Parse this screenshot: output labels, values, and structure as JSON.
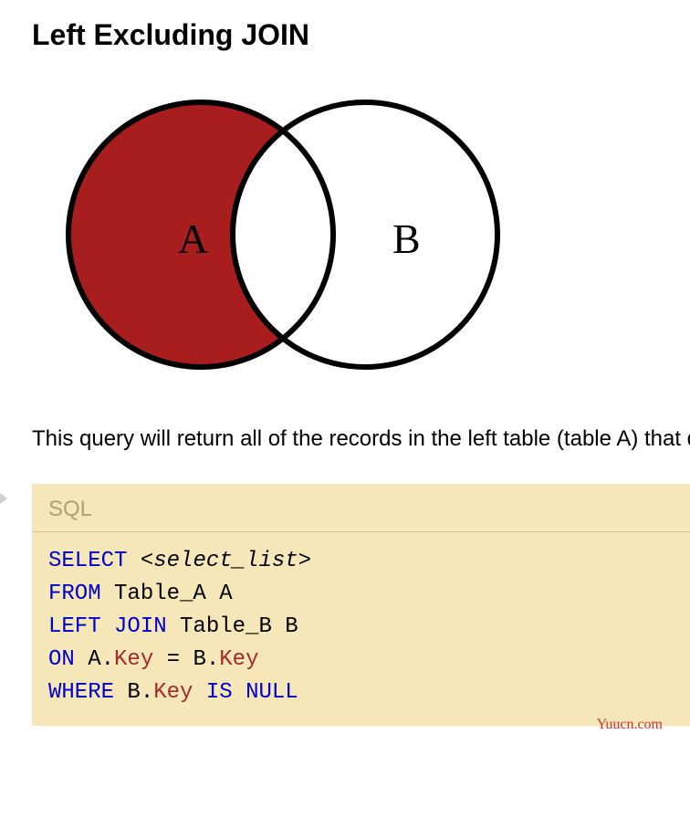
{
  "heading": "Left Excluding JOIN",
  "venn": {
    "labelA": "A",
    "labelB": "B"
  },
  "description": "This query will return all of the records in the left table (table A) that do not match any records in the right table (table B). This Join is written as follows:",
  "code": {
    "label": "SQL",
    "tokens": [
      {
        "t": "SELECT",
        "cls": "kw"
      },
      {
        "t": " ",
        "cls": "plain"
      },
      {
        "t": "<select_list>",
        "cls": "italic plain"
      },
      {
        "t": "\n",
        "cls": "plain"
      },
      {
        "t": "FROM",
        "cls": "kw"
      },
      {
        "t": " Table_A A\n",
        "cls": "plain"
      },
      {
        "t": "LEFT",
        "cls": "kw"
      },
      {
        "t": " ",
        "cls": "plain"
      },
      {
        "t": "JOIN",
        "cls": "kw"
      },
      {
        "t": " Table_B B\n",
        "cls": "plain"
      },
      {
        "t": "ON",
        "cls": "kw"
      },
      {
        "t": " A.",
        "cls": "plain"
      },
      {
        "t": "Key",
        "cls": "ident"
      },
      {
        "t": " = B.",
        "cls": "plain"
      },
      {
        "t": "Key",
        "cls": "ident"
      },
      {
        "t": "\n",
        "cls": "plain"
      },
      {
        "t": "WHERE",
        "cls": "kw"
      },
      {
        "t": " B.",
        "cls": "plain"
      },
      {
        "t": "Key",
        "cls": "ident"
      },
      {
        "t": " ",
        "cls": "plain"
      },
      {
        "t": "IS",
        "cls": "kw"
      },
      {
        "t": " ",
        "cls": "plain"
      },
      {
        "t": "NULL",
        "cls": "kw"
      }
    ]
  },
  "watermark": "Yuucn.com"
}
